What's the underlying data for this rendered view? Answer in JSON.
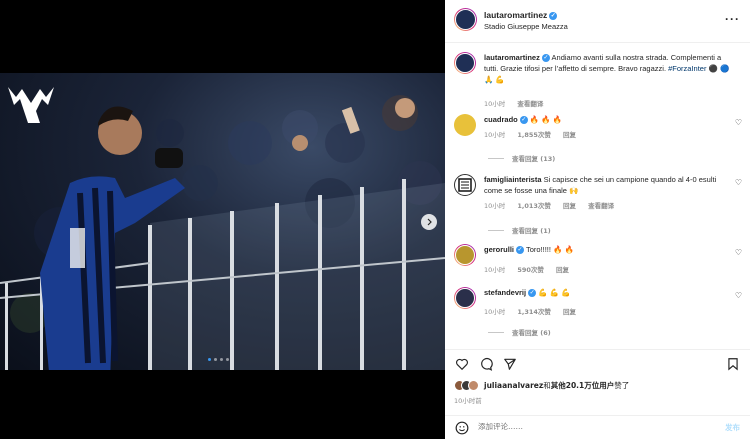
{
  "colors": {
    "accent": "#3897f0",
    "link": "#00376b",
    "muted": "#8e8e8e"
  },
  "media": {
    "carousel_dots": 4,
    "active_dot": 0,
    "next_icon": "chevron-right-icon"
  },
  "header": {
    "username": "lautaromartinez",
    "location": "Stadio Giuseppe Meazza",
    "more_icon": "more-horizontal-icon"
  },
  "caption": {
    "username": "lautaromartinez",
    "text": "Andiamo avanti sulla nostra strada. Complementi a tutti. Grazie tifosi per l’affetto di sempre. Bravo ragazzi.",
    "hashtag": "#ForzaInter",
    "emojis": "⚫ 🔵 🙏 💪",
    "time": "10小时"
  },
  "comments": [
    {
      "username": "cuadrado",
      "verified": true,
      "text": "🔥 🔥 🔥",
      "time": "10小时",
      "likes": "1,855次赞",
      "reply_label": "回复",
      "translate_label": "",
      "replies": "查看回复 (13)"
    },
    {
      "username": "famigliainterista",
      "verified": false,
      "text": "Si capisce che sei un campione quando al 4-0 esulti come se fosse una finale 🙌",
      "time": "10小时",
      "likes": "1,013次赞",
      "reply_label": "回复",
      "translate_label": "查看翻译",
      "replies": "查看回复 (1)"
    },
    {
      "username": "gerorulli",
      "verified": true,
      "text": "Toro!!!!! 🔥 🔥",
      "time": "10小时",
      "likes": "590次赞",
      "reply_label": "回复",
      "translate_label": "",
      "replies": ""
    },
    {
      "username": "stefandevrij",
      "verified": true,
      "text": "💪 💪 💪",
      "time": "10小时",
      "likes": "1,314次赞",
      "reply_label": "回复",
      "translate_label": "",
      "replies": "查看回复 (6)"
    }
  ],
  "caption_translate": "查看翻译",
  "likes": {
    "text_user": "juliaanalvarez",
    "text_rest": "和",
    "text_count": "其他20.1万位用户",
    "text_end": "赞了"
  },
  "post_time": "10小时前",
  "add_comment": {
    "placeholder": "添加评论……",
    "post_label": "发布"
  }
}
